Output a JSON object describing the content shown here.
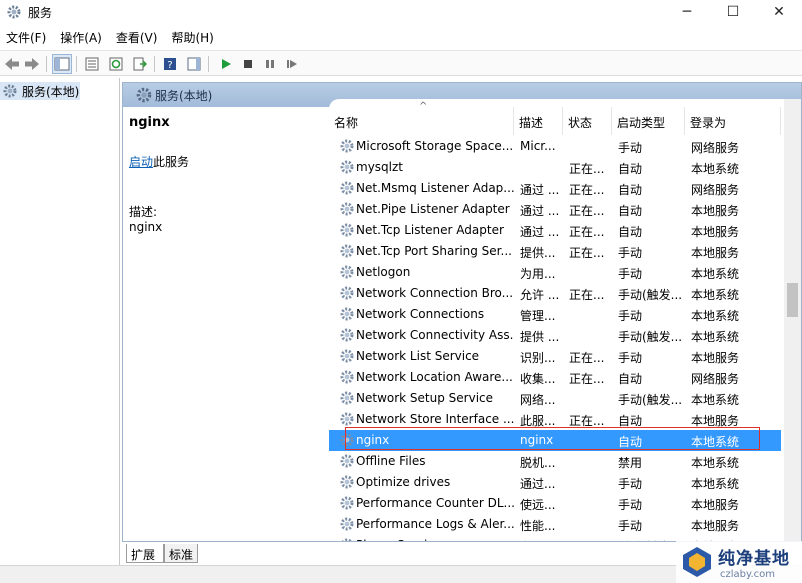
{
  "window": {
    "title": "服务",
    "minimize_glyph": "─",
    "maximize_glyph": "☐",
    "close_glyph": "✕"
  },
  "menu": [
    "文件(F)",
    "操作(A)",
    "查看(V)",
    "帮助(H)"
  ],
  "toolbar": {
    "icons": [
      "back-icon",
      "forward-icon",
      "show-hide-tree-icon",
      "properties-icon",
      "refresh-icon",
      "export-list-icon",
      "help-icon",
      "show-action-pane-icon",
      "start-service-icon",
      "stop-service-icon",
      "pause-service-icon",
      "restart-service-icon"
    ]
  },
  "tree": {
    "root_label": "服务(本地)"
  },
  "right_header": {
    "label": "服务(本地)"
  },
  "details": {
    "service_name": "nginx",
    "start_link": "启动",
    "start_suffix": "此服务",
    "desc_label": "描述:",
    "desc_value": "nginx"
  },
  "columns": {
    "name": "名称",
    "desc": "描述",
    "status": "状态",
    "start_type": "启动类型",
    "logon": "登录为"
  },
  "services": [
    {
      "name": "Microsoft Storage Space...",
      "desc": "Micr...",
      "status": "",
      "start": "手动",
      "logon": "网络服务"
    },
    {
      "name": "mysqlzt",
      "desc": "",
      "status": "正在...",
      "start": "自动",
      "logon": "本地系统"
    },
    {
      "name": "Net.Msmq Listener Adap...",
      "desc": "通过 ...",
      "status": "正在...",
      "start": "自动",
      "logon": "网络服务"
    },
    {
      "name": "Net.Pipe Listener Adapter",
      "desc": "通过 ...",
      "status": "正在...",
      "start": "自动",
      "logon": "本地服务"
    },
    {
      "name": "Net.Tcp Listener Adapter",
      "desc": "通过 ...",
      "status": "正在...",
      "start": "自动",
      "logon": "本地服务"
    },
    {
      "name": "Net.Tcp Port Sharing Ser...",
      "desc": "提供...",
      "status": "正在...",
      "start": "手动",
      "logon": "本地服务"
    },
    {
      "name": "Netlogon",
      "desc": "为用...",
      "status": "",
      "start": "手动",
      "logon": "本地系统"
    },
    {
      "name": "Network Connection Bro...",
      "desc": "允许 ...",
      "status": "正在...",
      "start": "手动(触发...",
      "logon": "本地系统"
    },
    {
      "name": "Network Connections",
      "desc": "管理...",
      "status": "",
      "start": "手动",
      "logon": "本地系统"
    },
    {
      "name": "Network Connectivity Ass...",
      "desc": "提供 ...",
      "status": "",
      "start": "手动(触发...",
      "logon": "本地系统"
    },
    {
      "name": "Network List Service",
      "desc": "识别...",
      "status": "正在...",
      "start": "手动",
      "logon": "本地服务"
    },
    {
      "name": "Network Location Aware...",
      "desc": "收集...",
      "status": "正在...",
      "start": "自动",
      "logon": "网络服务"
    },
    {
      "name": "Network Setup Service",
      "desc": "网络...",
      "status": "",
      "start": "手动(触发...",
      "logon": "本地系统"
    },
    {
      "name": "Network Store Interface ...",
      "desc": "此服...",
      "status": "正在...",
      "start": "自动",
      "logon": "本地服务"
    },
    {
      "name": "nginx",
      "desc": "nginx",
      "status": "",
      "start": "自动",
      "logon": "本地系统",
      "selected": true
    },
    {
      "name": "Offline Files",
      "desc": "脱机...",
      "status": "",
      "start": "禁用",
      "logon": "本地系统"
    },
    {
      "name": "Optimize drives",
      "desc": "通过...",
      "status": "",
      "start": "手动",
      "logon": "本地系统"
    },
    {
      "name": "Performance Counter DL...",
      "desc": "使远...",
      "status": "",
      "start": "手动",
      "logon": "本地服务"
    },
    {
      "name": "Performance Logs & Aler...",
      "desc": "性能...",
      "status": "",
      "start": "手动",
      "logon": "本地服务"
    },
    {
      "name": "Phone Service",
      "desc": "在设...",
      "status": "",
      "start": "手动(触发...",
      "logon": "本地服务"
    }
  ],
  "tabs": [
    "扩展",
    "标准"
  ],
  "watermark": {
    "title": "纯净基地",
    "subtitle": "czlaby.com"
  },
  "colors": {
    "selection": "#3399ff",
    "highlight_box": "#e0302a",
    "header_band": "#a2bbd9"
  }
}
